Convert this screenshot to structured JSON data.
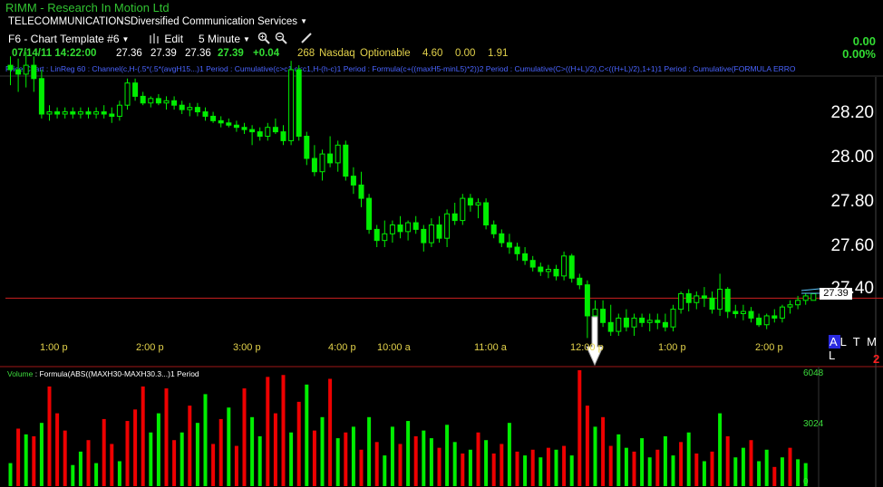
{
  "title": {
    "symbol": "RIMM",
    "separator": " - ",
    "company": "Research In Motion Ltd"
  },
  "industry": {
    "sector": "TELECOMMUNICATIONS",
    "subsector": "Diversified Communication Services"
  },
  "toolbar": {
    "template": "F6 - Chart Template #6",
    "edit": "Edit",
    "interval": "5 Minute"
  },
  "quote": {
    "datetime": "07/14/11 14:22:00",
    "open": "27.36",
    "high": "27.39",
    "low": "27.36",
    "close": "27.39",
    "change": "+0.04",
    "volume": "268",
    "exchange": "Nasdaq",
    "optionable": "Optionable",
    "v1": "4.60",
    "v2": "0.00",
    "v3": "1.91",
    "chg_right": "0.00",
    "pct_right": "0.00%"
  },
  "studies": "Price Chart : LinReg 60 : Channel(c,H-(.5*(.5*(avgH15...)1 Period : Cumulative(c>c1,c<c1,H-(h-c)1 Period : Formula(c+((maxH5-minL5)*2))2 Period : Cumulative(C>((H+L)/2),C<((H+L)/2),1+1)1 Period : Cumulative(FORMULA ERRO",
  "price_axis": [
    "28.20",
    "28.00",
    "27.80",
    "27.60",
    "27.40"
  ],
  "time_axis": [
    "1:00 p",
    "2:00 p",
    "3:00 p",
    "4:00 p",
    "10:00 a",
    "11:00 a",
    "12:00 p",
    "1:00 p",
    "2:00 p"
  ],
  "last_price_tag": "27.39",
  "toolbar_right": {
    "A": "A",
    "rest": "L T M L"
  },
  "red_mark": "2",
  "volume_panel": {
    "label_name": "Volume",
    "formula": "Formula(ABS((MAXH30-MAXH30.3...)1 Period",
    "axis": [
      "6048",
      "3024",
      "0"
    ]
  },
  "colors": {
    "up": "#00ee00",
    "down": "#ee0000",
    "text_green": "#33dd33",
    "study_blue": "#4a64ff",
    "ref_line": "#cc2020"
  },
  "chart_data": {
    "type": "candlestick",
    "price_range": [
      27.22,
      28.5
    ],
    "reference_line": 27.37,
    "candles": [
      [
        28.42,
        28.46,
        28.33,
        28.4
      ],
      [
        28.4,
        28.45,
        28.3,
        28.38
      ],
      [
        28.38,
        28.48,
        28.32,
        28.42
      ],
      [
        28.42,
        28.46,
        28.3,
        28.36
      ],
      [
        28.36,
        28.4,
        28.18,
        28.2
      ],
      [
        28.2,
        28.24,
        28.17,
        28.21
      ],
      [
        28.21,
        28.23,
        28.18,
        28.2
      ],
      [
        28.2,
        28.23,
        28.18,
        28.21
      ],
      [
        28.21,
        28.23,
        28.18,
        28.2
      ],
      [
        28.2,
        28.23,
        28.18,
        28.21
      ],
      [
        28.21,
        28.23,
        28.18,
        28.2
      ],
      [
        28.2,
        28.23,
        28.18,
        28.21
      ],
      [
        28.21,
        28.24,
        28.18,
        28.2
      ],
      [
        28.2,
        28.23,
        28.16,
        28.19
      ],
      [
        28.19,
        28.26,
        28.17,
        28.24
      ],
      [
        28.24,
        28.36,
        28.22,
        28.34
      ],
      [
        28.34,
        28.36,
        28.26,
        28.28
      ],
      [
        28.28,
        28.3,
        28.24,
        28.25
      ],
      [
        28.25,
        28.28,
        28.23,
        28.27
      ],
      [
        28.27,
        28.29,
        28.24,
        28.25
      ],
      [
        28.25,
        28.28,
        28.22,
        28.26
      ],
      [
        28.26,
        28.28,
        28.22,
        28.24
      ],
      [
        28.24,
        28.26,
        28.2,
        28.22
      ],
      [
        28.22,
        28.25,
        28.19,
        28.23
      ],
      [
        28.23,
        28.25,
        28.19,
        28.21
      ],
      [
        28.21,
        28.23,
        28.17,
        28.19
      ],
      [
        28.19,
        28.21,
        28.16,
        28.17
      ],
      [
        28.17,
        28.19,
        28.14,
        28.16
      ],
      [
        28.16,
        28.18,
        28.14,
        28.15
      ],
      [
        28.15,
        28.17,
        28.12,
        28.14
      ],
      [
        28.14,
        28.16,
        28.11,
        28.13
      ],
      [
        28.13,
        28.15,
        28.06,
        28.12
      ],
      [
        28.12,
        28.14,
        28.08,
        28.1
      ],
      [
        28.1,
        28.16,
        28.08,
        28.14
      ],
      [
        28.14,
        28.18,
        28.11,
        28.12
      ],
      [
        28.12,
        28.15,
        28.06,
        28.08
      ],
      [
        28.08,
        28.44,
        28.06,
        28.4
      ],
      [
        28.4,
        28.42,
        28.08,
        28.1
      ],
      [
        28.1,
        28.12,
        27.97,
        28.0
      ],
      [
        28.0,
        28.06,
        27.92,
        27.94
      ],
      [
        27.94,
        28.04,
        27.9,
        28.02
      ],
      [
        28.02,
        28.1,
        27.96,
        27.98
      ],
      [
        27.98,
        28.08,
        27.94,
        28.06
      ],
      [
        28.06,
        28.08,
        27.9,
        27.92
      ],
      [
        27.92,
        27.96,
        27.84,
        27.88
      ],
      [
        27.88,
        27.94,
        27.78,
        27.82
      ],
      [
        27.82,
        27.84,
        27.66,
        27.68
      ],
      [
        27.68,
        27.7,
        27.6,
        27.63
      ],
      [
        27.63,
        27.72,
        27.6,
        27.66
      ],
      [
        27.66,
        27.72,
        27.62,
        27.7
      ],
      [
        27.7,
        27.74,
        27.64,
        27.67
      ],
      [
        27.67,
        27.72,
        27.63,
        27.71
      ],
      [
        27.71,
        27.74,
        27.66,
        27.68
      ],
      [
        27.68,
        27.7,
        27.58,
        27.62
      ],
      [
        27.62,
        27.73,
        27.6,
        27.7
      ],
      [
        27.7,
        27.74,
        27.62,
        27.64
      ],
      [
        27.64,
        27.77,
        27.6,
        27.75
      ],
      [
        27.75,
        27.8,
        27.7,
        27.72
      ],
      [
        27.72,
        27.84,
        27.7,
        27.82
      ],
      [
        27.82,
        27.84,
        27.76,
        27.79
      ],
      [
        27.79,
        27.82,
        27.73,
        27.8
      ],
      [
        27.8,
        27.82,
        27.68,
        27.7
      ],
      [
        27.7,
        27.72,
        27.64,
        27.66
      ],
      [
        27.66,
        27.68,
        27.6,
        27.62
      ],
      [
        27.62,
        27.66,
        27.57,
        27.6
      ],
      [
        27.6,
        27.62,
        27.54,
        27.57
      ],
      [
        27.57,
        27.6,
        27.52,
        27.54
      ],
      [
        27.54,
        27.56,
        27.49,
        27.51
      ],
      [
        27.51,
        27.53,
        27.47,
        27.49
      ],
      [
        27.49,
        27.52,
        27.46,
        27.5
      ],
      [
        27.5,
        27.52,
        27.45,
        27.47
      ],
      [
        27.47,
        27.58,
        27.45,
        27.56
      ],
      [
        27.56,
        27.57,
        27.44,
        27.46
      ],
      [
        27.46,
        27.48,
        27.41,
        27.43
      ],
      [
        27.43,
        27.45,
        27.19,
        27.29
      ],
      [
        27.29,
        27.36,
        27.22,
        27.32
      ],
      [
        27.32,
        27.36,
        27.24,
        27.26
      ],
      [
        27.26,
        27.34,
        27.2,
        27.22
      ],
      [
        27.22,
        27.3,
        27.2,
        27.28
      ],
      [
        27.28,
        27.32,
        27.22,
        27.24
      ],
      [
        27.24,
        27.3,
        27.2,
        27.28
      ],
      [
        27.28,
        27.3,
        27.24,
        27.26
      ],
      [
        27.26,
        27.3,
        27.22,
        27.27
      ],
      [
        27.27,
        27.3,
        27.23,
        27.26
      ],
      [
        27.26,
        27.3,
        27.22,
        27.24
      ],
      [
        27.24,
        27.34,
        27.22,
        27.32
      ],
      [
        27.32,
        27.4,
        27.3,
        27.39
      ],
      [
        27.39,
        27.41,
        27.31,
        27.35
      ],
      [
        27.35,
        27.4,
        27.32,
        27.38
      ],
      [
        27.38,
        27.42,
        27.33,
        27.37
      ],
      [
        27.37,
        27.4,
        27.3,
        27.32
      ],
      [
        27.32,
        27.48,
        27.29,
        27.41
      ],
      [
        27.41,
        27.42,
        27.28,
        27.31
      ],
      [
        27.31,
        27.34,
        27.28,
        27.3
      ],
      [
        27.3,
        27.34,
        27.27,
        27.31
      ],
      [
        27.31,
        27.33,
        27.26,
        27.28
      ],
      [
        27.28,
        27.3,
        27.24,
        27.25
      ],
      [
        27.25,
        27.3,
        27.23,
        27.29
      ],
      [
        27.29,
        27.32,
        27.26,
        27.28
      ],
      [
        27.28,
        27.34,
        27.26,
        27.33
      ],
      [
        27.33,
        27.36,
        27.3,
        27.34
      ],
      [
        27.34,
        27.38,
        27.32,
        27.36
      ],
      [
        27.36,
        27.39,
        27.34,
        27.38
      ],
      [
        27.36,
        27.39,
        27.36,
        27.39
      ]
    ],
    "volume_max": 6048,
    "volume": [
      [
        1200,
        1
      ],
      [
        3000,
        0
      ],
      [
        2700,
        1
      ],
      [
        2600,
        0
      ],
      [
        3300,
        1
      ],
      [
        5200,
        0
      ],
      [
        3800,
        0
      ],
      [
        2900,
        0
      ],
      [
        1100,
        1
      ],
      [
        1800,
        1
      ],
      [
        2400,
        0
      ],
      [
        1200,
        1
      ],
      [
        3500,
        0
      ],
      [
        2200,
        0
      ],
      [
        1300,
        1
      ],
      [
        3400,
        0
      ],
      [
        4000,
        0
      ],
      [
        5200,
        0
      ],
      [
        2800,
        1
      ],
      [
        3800,
        1
      ],
      [
        5100,
        0
      ],
      [
        2400,
        0
      ],
      [
        2800,
        1
      ],
      [
        4200,
        0
      ],
      [
        3300,
        1
      ],
      [
        4800,
        1
      ],
      [
        2200,
        0
      ],
      [
        3500,
        0
      ],
      [
        4100,
        1
      ],
      [
        2100,
        0
      ],
      [
        5100,
        0
      ],
      [
        3600,
        1
      ],
      [
        2600,
        1
      ],
      [
        5700,
        0
      ],
      [
        3800,
        0
      ],
      [
        5800,
        0
      ],
      [
        2800,
        1
      ],
      [
        4400,
        0
      ],
      [
        5300,
        1
      ],
      [
        2900,
        0
      ],
      [
        3600,
        1
      ],
      [
        5600,
        0
      ],
      [
        2500,
        1
      ],
      [
        2800,
        0
      ],
      [
        3100,
        1
      ],
      [
        1900,
        0
      ],
      [
        3600,
        1
      ],
      [
        2300,
        0
      ],
      [
        1600,
        1
      ],
      [
        3100,
        1
      ],
      [
        2200,
        0
      ],
      [
        3400,
        1
      ],
      [
        2600,
        0
      ],
      [
        2900,
        1
      ],
      [
        2500,
        1
      ],
      [
        2000,
        0
      ],
      [
        3200,
        1
      ],
      [
        2300,
        1
      ],
      [
        1700,
        0
      ],
      [
        1900,
        1
      ],
      [
        2800,
        0
      ],
      [
        2400,
        1
      ],
      [
        1700,
        0
      ],
      [
        2200,
        0
      ],
      [
        3300,
        1
      ],
      [
        1800,
        0
      ],
      [
        1600,
        1
      ],
      [
        1900,
        0
      ],
      [
        1500,
        1
      ],
      [
        2000,
        0
      ],
      [
        1900,
        1
      ],
      [
        2100,
        0
      ],
      [
        1600,
        1
      ],
      [
        6048,
        0
      ],
      [
        4200,
        0
      ],
      [
        3100,
        1
      ],
      [
        3600,
        0
      ],
      [
        2100,
        0
      ],
      [
        2700,
        1
      ],
      [
        2000,
        1
      ],
      [
        1800,
        0
      ],
      [
        2500,
        1
      ],
      [
        1500,
        1
      ],
      [
        1900,
        0
      ],
      [
        2600,
        1
      ],
      [
        1600,
        1
      ],
      [
        2300,
        0
      ],
      [
        2800,
        1
      ],
      [
        1700,
        0
      ],
      [
        1300,
        1
      ],
      [
        1800,
        0
      ],
      [
        3800,
        1
      ],
      [
        2600,
        0
      ],
      [
        1500,
        1
      ],
      [
        2000,
        1
      ],
      [
        2400,
        0
      ],
      [
        1300,
        1
      ],
      [
        1900,
        1
      ],
      [
        1000,
        0
      ],
      [
        1500,
        1
      ],
      [
        2000,
        0
      ],
      [
        1400,
        1
      ],
      [
        1200,
        1
      ]
    ]
  }
}
